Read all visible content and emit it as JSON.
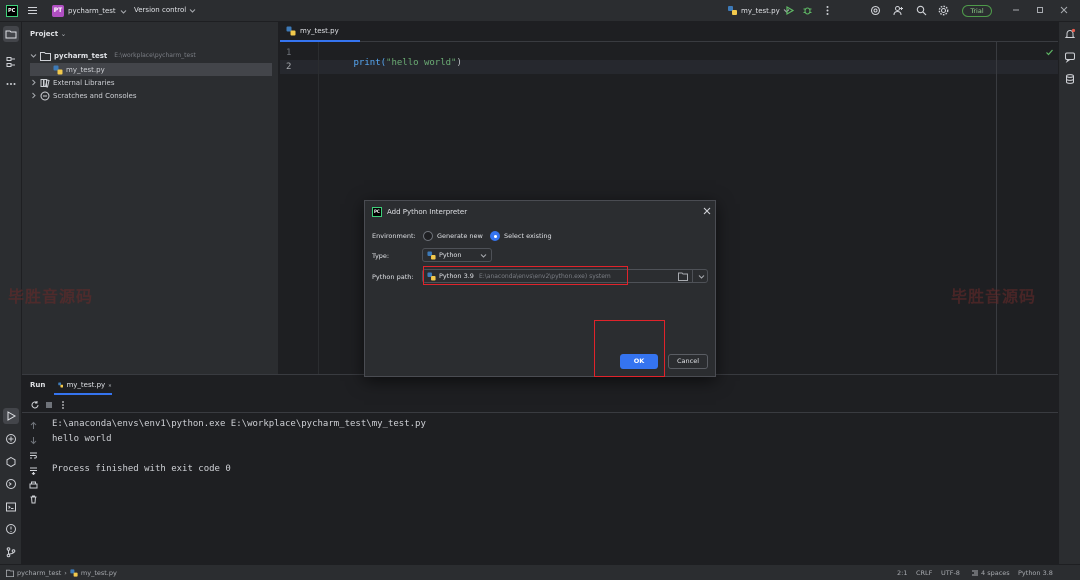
{
  "titlebar": {
    "project_badge": "PT",
    "project_name": "pycharm_test",
    "vcs": "Version control",
    "run_config": "my_test.py",
    "trial_label": "Trial"
  },
  "project_panel": {
    "title": "Project",
    "root_name": "pycharm_test",
    "root_path": "E:\\workplace\\pycharm_test",
    "file": "my_test.py",
    "external_libs": "External Libraries",
    "scratches": "Scratches and Consoles"
  },
  "editor": {
    "tab": "my_test.py",
    "lines": [
      {
        "num": "1",
        "code_fn": "print(",
        "code_str": "\"hello world\"",
        "code_end": ")"
      },
      {
        "num": "2"
      }
    ]
  },
  "watermark": "毕胜音源码",
  "run_panel": {
    "label": "Run",
    "tab": "my_test.py",
    "output": [
      "E:\\anaconda\\envs\\env1\\python.exe E:\\workplace\\pycharm_test\\my_test.py",
      "hello world",
      "",
      "Process finished with exit code 0"
    ]
  },
  "dialog": {
    "title": "Add Python Interpreter",
    "environment_label": "Environment:",
    "generate_new": "Generate new",
    "select_existing": "Select existing",
    "type_label": "Type:",
    "type_value": "Python",
    "path_label": "Python path:",
    "path_version": "Python 3.9",
    "path_detail": "E:\\anaconda\\envs\\env2\\python.exe) system",
    "ok": "OK",
    "cancel": "Cancel",
    "highlight_color": "#e0232b"
  },
  "statusbar": {
    "crumb_project": "pycharm_test",
    "crumb_file": "my_test.py",
    "position": "2:1",
    "line_sep": "CRLF",
    "encoding": "UTF-8",
    "indent": "4 spaces",
    "interpreter": "Python 3.8"
  },
  "colors": {
    "accent": "#3574f0",
    "background": "#1e1f22",
    "panel": "#2b2d30"
  }
}
